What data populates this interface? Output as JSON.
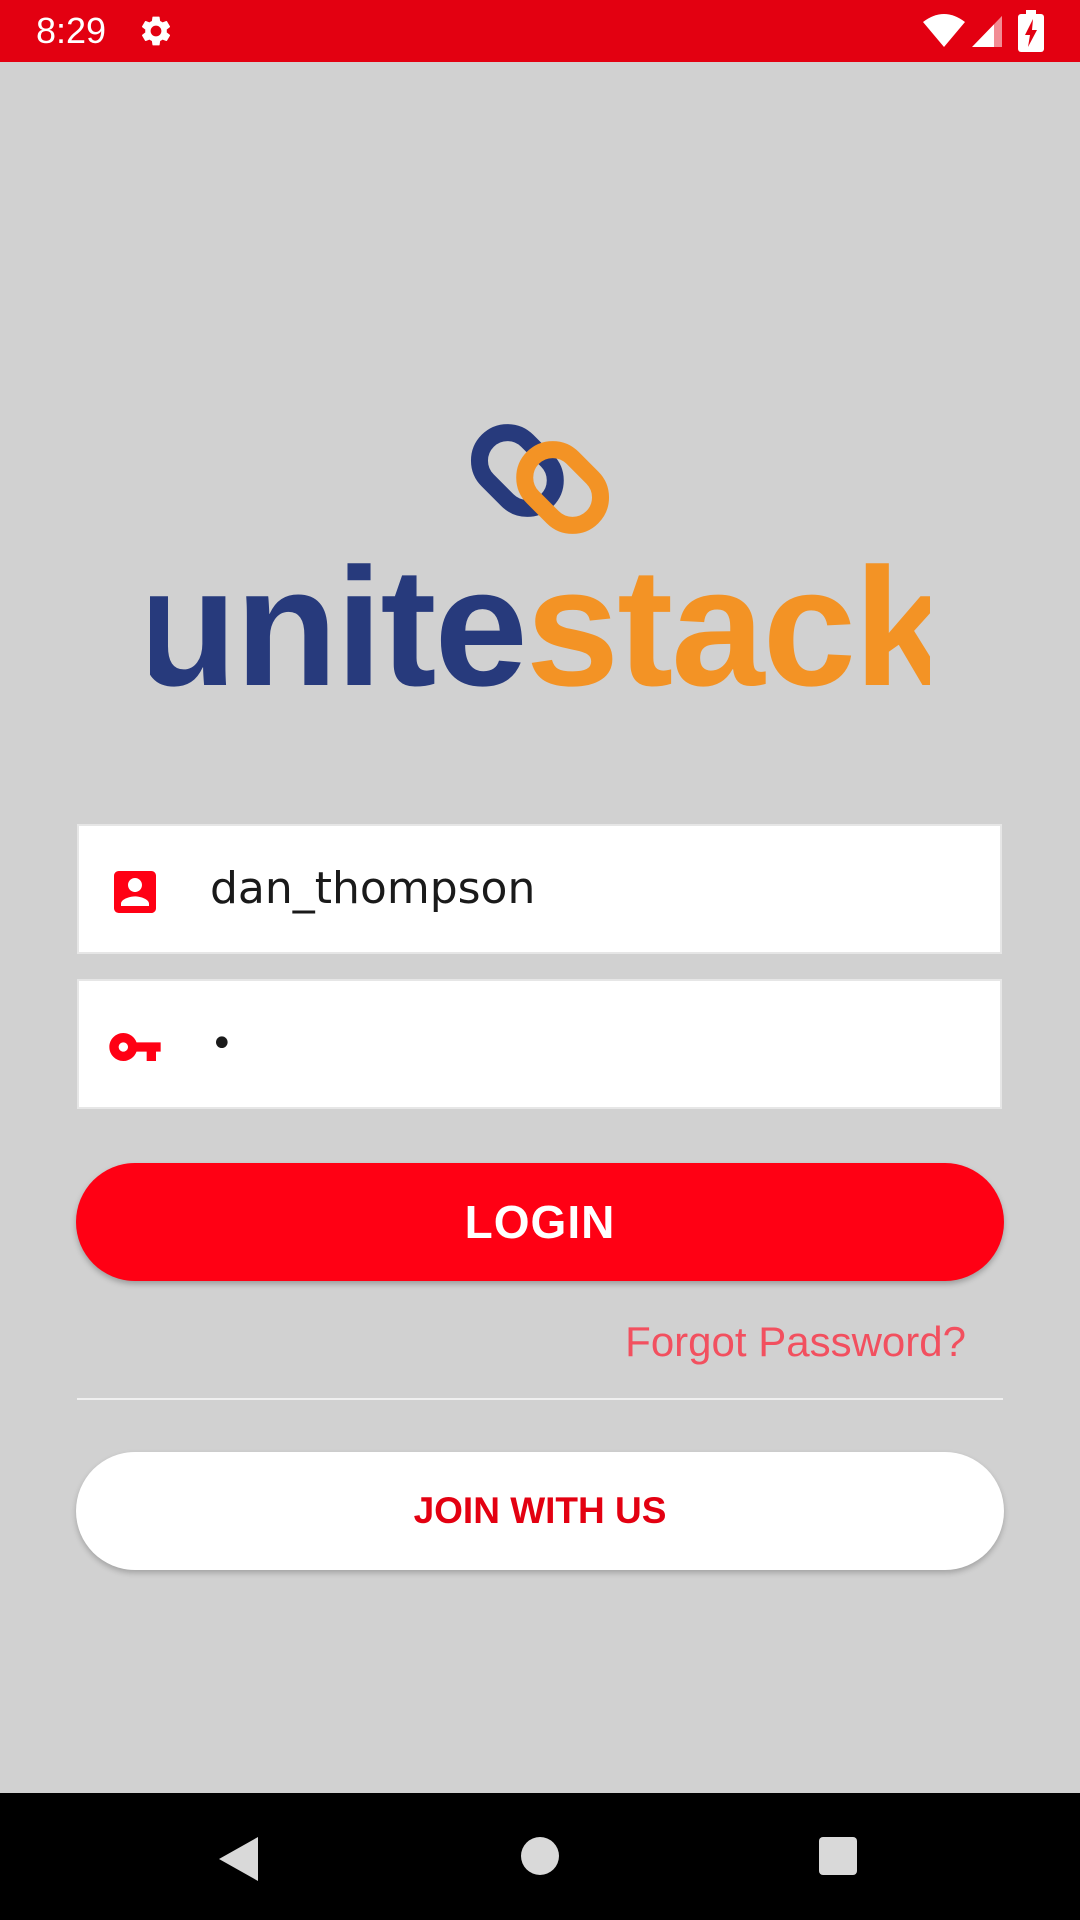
{
  "status_bar": {
    "time": "8:29",
    "icons": [
      "gear-icon",
      "wifi-icon",
      "signal-icon",
      "battery-charging-icon"
    ]
  },
  "logo": {
    "text_part1": "unite",
    "text_part2": "stack",
    "color_primary": "#273a7c",
    "color_accent": "#f39325"
  },
  "login_form": {
    "username_value": "dan_thompson",
    "username_icon": "account-box-icon",
    "password_value": "•",
    "password_icon": "key-icon",
    "login_label": "LOGIN",
    "forgot_label": "Forgot Password?",
    "join_label": "JOIN WITH US"
  },
  "colors": {
    "brand_red": "#ff0014",
    "status_bar": "#e30011",
    "background": "#d1d1d1",
    "forgot_link": "#f2505f"
  },
  "nav_bar": {
    "icons": [
      "back-icon",
      "home-icon",
      "recents-icon"
    ]
  }
}
